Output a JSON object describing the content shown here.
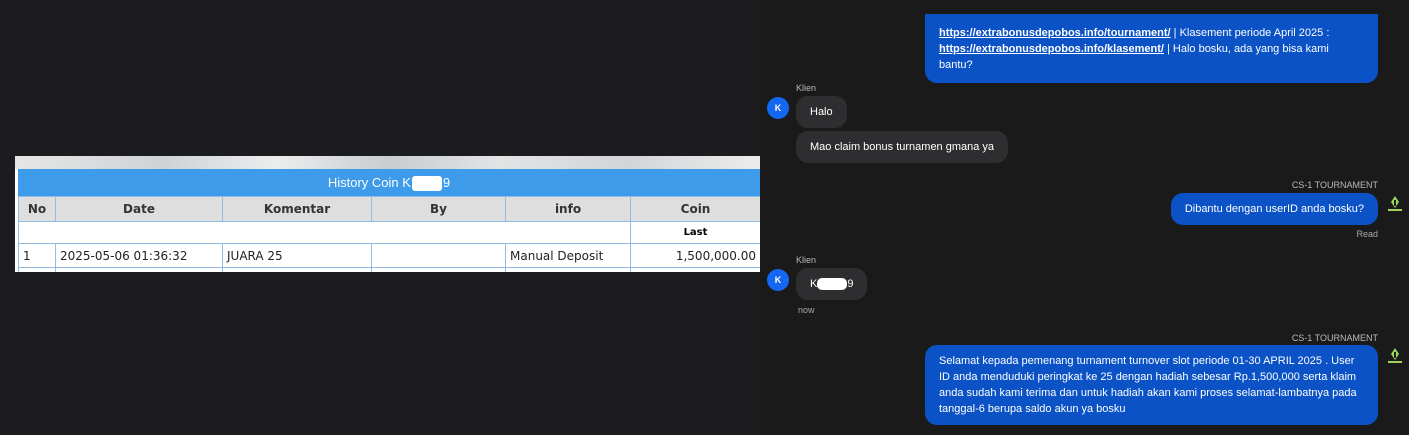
{
  "history": {
    "title_prefix": "History Coin K",
    "title_suffix": "9",
    "columns": [
      "No",
      "Date",
      "Komentar",
      "By",
      "info",
      "Coin"
    ],
    "sub_header": "Last",
    "rows": [
      {
        "no": "1",
        "date": "2025-05-06 01:36:32",
        "komentar": "JUARA 25",
        "by": "",
        "info": "Manual Deposit",
        "coin": "1,500,000.00"
      }
    ]
  },
  "chat": {
    "top_message": {
      "link1": "https://extrabonusdepobos.info/tournament/",
      "text1": " | Klasement periode April 2025 :",
      "link2": "https://extrabonusdepobos.info/klasement/",
      "text2": " | Halo bosku, ada yang bisa kami bantu?"
    },
    "client_label": "Klien",
    "client_avatar": "K",
    "client_msg1": "Halo",
    "client_msg2": "Mao claim bonus turnamen gmana ya",
    "agent_label": "CS-1 TOURNAMENT",
    "agent_msg1": "Dibantu dengan userID anda bosku?",
    "read_status": "Read",
    "client_msg3_prefix": "K",
    "client_msg3_suffix": "9",
    "time_now": "now",
    "agent_msg2": "Selamat kepada pemenang turnament turnover slot periode 01-30 APRIL 2025 . User ID anda menduduki peringkat ke 25 dengan hadiah sebesar Rp.1,500,000 serta klaim anda sudah kami terima dan untuk hadiah akan kami proses selamat-lambatnya pada tanggal-6 berupa saldo akun ya bosku"
  },
  "colors": {
    "agent_bubble": "#0a52c6",
    "client_bubble": "#2e2e30",
    "table_header": "#3d9be9",
    "coin_text": "#1e8a1e"
  }
}
